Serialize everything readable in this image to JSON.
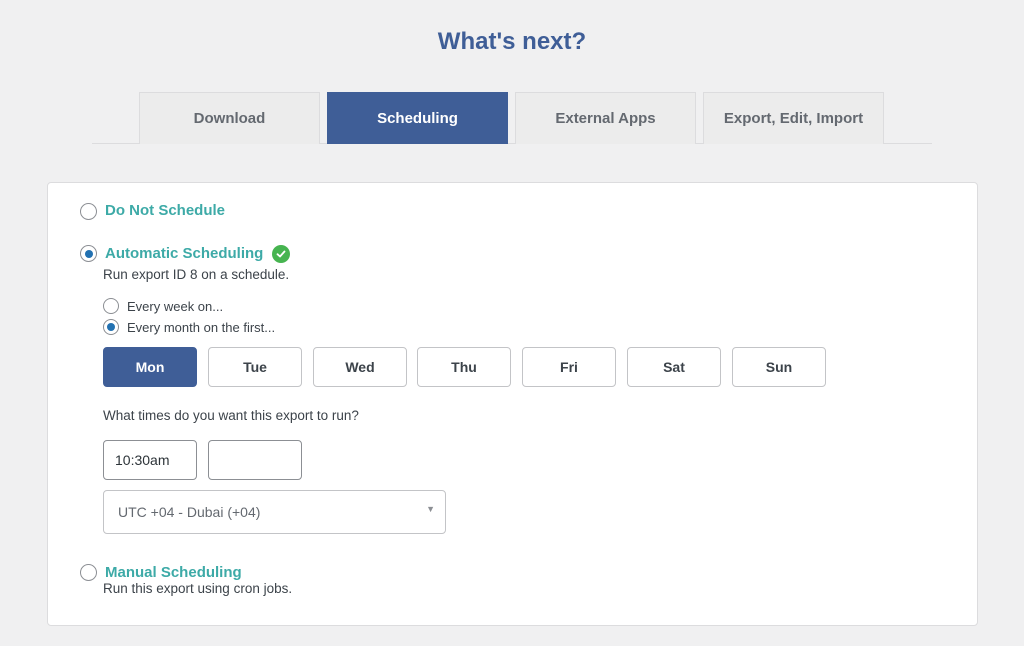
{
  "page": {
    "title": "What's next?"
  },
  "tabs": [
    {
      "label": "Download"
    },
    {
      "label": "Scheduling",
      "active": true
    },
    {
      "label": "External Apps"
    },
    {
      "label": "Export, Edit, Import"
    }
  ],
  "options": {
    "do_not_schedule": {
      "label": "Do Not Schedule",
      "checked": false
    },
    "automatic": {
      "label": "Automatic Scheduling",
      "checked": true,
      "description": "Run export ID 8 on a schedule.",
      "status_icon": "check-circle-icon"
    },
    "manual": {
      "label": "Manual Scheduling",
      "checked": false,
      "description": "Run this export using cron jobs."
    }
  },
  "frequency": [
    {
      "label": "Every week on...",
      "checked": false
    },
    {
      "label": "Every month on the first...",
      "checked": true
    }
  ],
  "days": [
    {
      "label": "Mon",
      "active": true
    },
    {
      "label": "Tue"
    },
    {
      "label": "Wed"
    },
    {
      "label": "Thu"
    },
    {
      "label": "Fri"
    },
    {
      "label": "Sat"
    },
    {
      "label": "Sun"
    }
  ],
  "times": {
    "question": "What times do you want this export to run?",
    "values": [
      "10:30am",
      ""
    ]
  },
  "timezone": {
    "selected": "UTC +04 - Dubai (+04)"
  },
  "colors": {
    "accent": "#3f5e97",
    "option_label": "#3daaa7",
    "success": "#46b450",
    "radio_checked": "#2271b1"
  }
}
